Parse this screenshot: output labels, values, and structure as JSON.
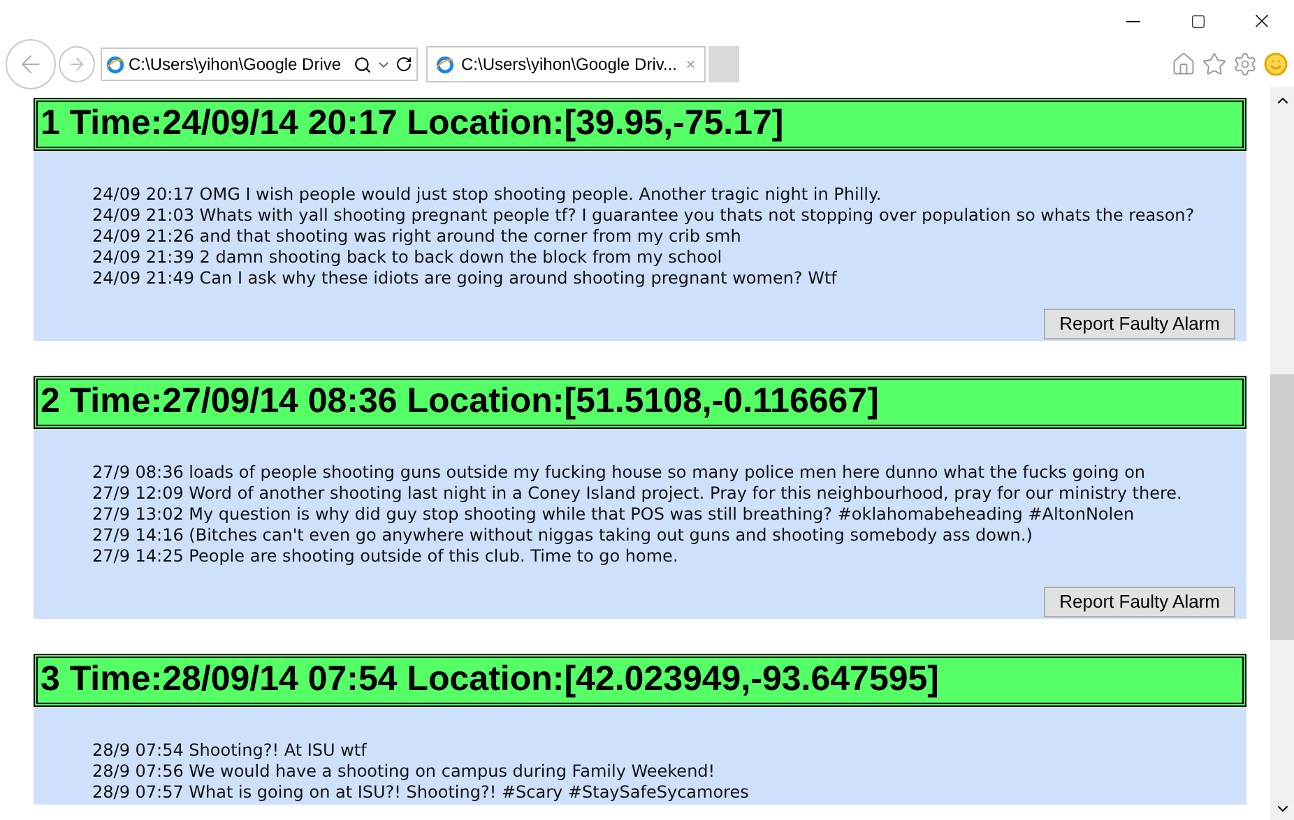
{
  "browser": {
    "address": "C:\\Users\\yihon\\Google Drive",
    "tabs": [
      {
        "title": "C:\\Users\\yihon\\Google Driv...",
        "selected": true
      }
    ]
  },
  "alarms": [
    {
      "number": "1",
      "heading": "Time:24/09/14 20:17 Location:[39.95,-75.17]",
      "messages": [
        "24/09 20:17 OMG I wish people would just stop shooting people. Another tragic night in Philly.",
        "24/09 21:03 Whats with yall shooting pregnant people tf? I guarantee you thats not stopping over population so whats the reason?",
        "24/09 21:26 and that shooting was right around the corner from my crib smh",
        "24/09 21:39 2 damn shooting back to back down the block from my school",
        "24/09 21:49 Can I ask why these idiots are going around shooting pregnant women? Wtf"
      ],
      "button": "Report Faulty Alarm"
    },
    {
      "number": "2",
      "heading": "Time:27/09/14 08:36 Location:[51.5108,-0.116667]",
      "messages": [
        "27/9 08:36 loads of people shooting guns outside my fucking house so many police men here dunno what the fucks going on",
        "27/9 12:09 Word of another shooting last night in a Coney Island project. Pray for this neighbourhood, pray for our ministry there.",
        "27/9 13:02 My question is why did guy stop shooting while that POS was still breathing? #oklahomabeheading #AltonNolen",
        "27/9 14:16 (Bitches can't even go anywhere without niggas taking out guns and shooting somebody ass down.)",
        "27/9 14:25 People are shooting outside of this club. Time to go home."
      ],
      "button": "Report Faulty Alarm"
    },
    {
      "number": "3",
      "heading": "Time:28/09/14 07:54 Location:[42.023949,-93.647595]",
      "messages": [
        "28/9 07:54 Shooting?! At ISU wtf",
        "28/9 07:56 We would have a shooting on campus during Family Weekend!",
        "28/9 07:57 What is going on at ISU?! Shooting?! #Scary #StaySafeSycamores"
      ]
    }
  ]
}
